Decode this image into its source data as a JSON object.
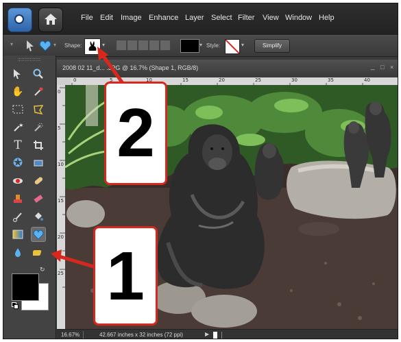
{
  "menubar": {
    "items": [
      "File",
      "Edit",
      "Image",
      "Enhance",
      "Layer",
      "Select",
      "Filter",
      "View",
      "Window",
      "Help"
    ]
  },
  "options": {
    "shape_label": "Shape:",
    "style_label": "Style:",
    "simplify_label": "Simplify"
  },
  "document": {
    "title": "2008 02 11_d... .JPG @ 16.7% (Shape 1, RGB/8)",
    "ruler_ticks": [
      "0",
      "5",
      "10",
      "15",
      "20",
      "25",
      "30",
      "35",
      "40"
    ],
    "ruler_left_ticks": [
      "0",
      "5",
      "10",
      "15",
      "20",
      "25"
    ],
    "zoom": "16.67%",
    "size_info": "42.667 inches x 32 inches (72 ppi)"
  },
  "callouts": {
    "one": "1",
    "two": "2"
  },
  "colors": {
    "accent_red": "#d8281e",
    "foreground": "#000000",
    "background": "#ffffff"
  }
}
